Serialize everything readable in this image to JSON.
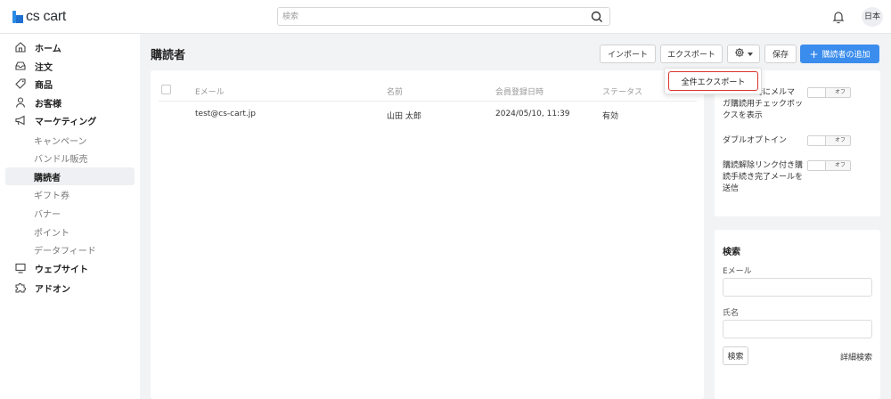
{
  "header": {
    "logo_text": "cs cart",
    "search_placeholder": "検索",
    "language": "日本"
  },
  "sidebar": {
    "items": [
      {
        "label": "ホーム",
        "icon": "home-icon"
      },
      {
        "label": "注文",
        "icon": "inbox-icon"
      },
      {
        "label": "商品",
        "icon": "tag-icon"
      },
      {
        "label": "お客様",
        "icon": "user-icon"
      },
      {
        "label": "マーケティング",
        "icon": "megaphone-icon"
      }
    ],
    "marketing_sub": [
      {
        "label": "キャンペーン"
      },
      {
        "label": "バンドル販売"
      },
      {
        "label": "購読者",
        "active": true
      },
      {
        "label": "ギフト券"
      },
      {
        "label": "バナー"
      },
      {
        "label": "ポイント"
      },
      {
        "label": "データフィード"
      }
    ],
    "bottom_items": [
      {
        "label": "ウェブサイト",
        "icon": "monitor-icon"
      },
      {
        "label": "アドオン",
        "icon": "puzzle-icon"
      }
    ]
  },
  "page": {
    "title": "購読者",
    "buttons": {
      "import": "インポート",
      "export": "エクスポート",
      "save": "保存",
      "add": "購読者の追加"
    }
  },
  "dropdown": {
    "item": "全件エクスポート"
  },
  "table": {
    "headers": [
      "Eメール",
      "名前",
      "会員登録日時",
      "ステータス"
    ],
    "rows": [
      [
        "test@cs-cart.jp",
        "山田 太郎",
        "2024/05/10, 11:39",
        "有効"
      ]
    ]
  },
  "options": {
    "opt1": "ユーザー登録時にメルマガ購読用チェックボックスを表示",
    "opt1_visible_line1": "時にメルマ",
    "opt1_line2": "ガ購読用チェックボッ",
    "opt1_line3": "クスを表示",
    "opt2": "ダブルオプトイン",
    "opt3_line1": "購読解除リンク付き購",
    "opt3_line2": "読手続き完了メールを",
    "opt3_line3": "送信",
    "toggle_off": "オフ"
  },
  "search_panel": {
    "title": "検索",
    "email_label": "Eメール",
    "name_label": "氏名",
    "search_button": "検索",
    "advanced": "詳細検索"
  },
  "colors": {
    "primary": "#3b8ded",
    "highlight_border": "#d9342b",
    "active_nav_bg": "#eef0f3",
    "main_bg": "#f2f3f5"
  }
}
